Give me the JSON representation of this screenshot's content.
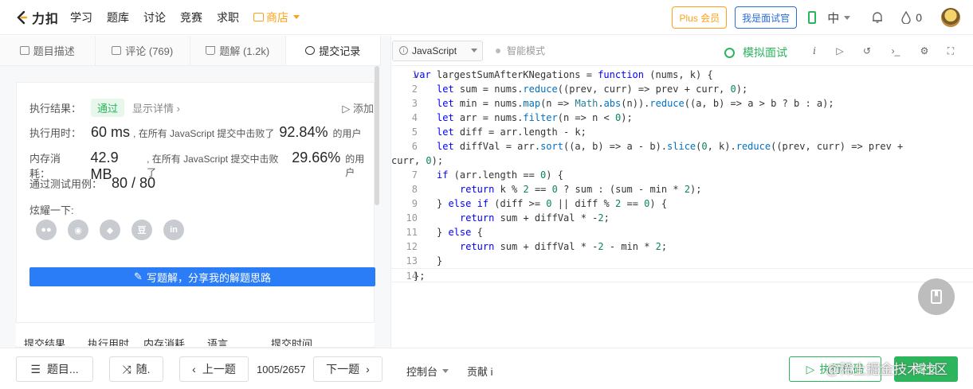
{
  "header": {
    "logo_text": "力扣",
    "nav": [
      "学习",
      "题库",
      "讨论",
      "竞赛",
      "求职"
    ],
    "store_label": "商店",
    "plus_label": "Plus 会员",
    "interview_label": "我是面试官",
    "lang_label": "中",
    "drops_count": "0"
  },
  "left_tabs": [
    {
      "label": "题目描述",
      "icon": "description-icon"
    },
    {
      "label": "评论 (769)",
      "icon": "comment-icon"
    },
    {
      "label": "题解 (1.2k)",
      "icon": "flask-icon"
    },
    {
      "label": "提交记录",
      "icon": "clock-icon"
    }
  ],
  "result": {
    "label": "执行结果：",
    "status": "通过",
    "detail_link": "显示详情 ›",
    "add_link": "▷ 添加",
    "runtime_label": "执行用时：",
    "runtime_value": "60 ms",
    "runtime_prefix": ", 在所有 JavaScript 提交中击败了",
    "runtime_pct": "92.84%",
    "runtime_suffix": "的用户",
    "memory_label": "内存消耗：",
    "memory_value": "42.9 MB",
    "memory_prefix": ", 在所有 JavaScript 提交中击败了",
    "memory_pct": "29.66%",
    "memory_suffix": "的用户",
    "tests_label": "通过测试用例：",
    "tests_value": "80 / 80",
    "share_label": "炫耀一下:",
    "share_icons": [
      "wechat-icon",
      "weibo-icon",
      "qq-icon",
      "douban-icon",
      "linkedin-icon"
    ],
    "write_button": "写题解，分享我的解题思路"
  },
  "history_header": [
    "提交结果",
    "执行用时",
    "内存消耗",
    "语言",
    "提交时间"
  ],
  "bottom": {
    "problems_label": "题目...",
    "random_label": "随.",
    "prev_label": "上一题",
    "page_count": "1005/2657",
    "next_label": "下一题",
    "console_label": "控制台",
    "contrib_label": "贡献 i",
    "run_label": "执行代码",
    "submit_label": "提交",
    "watermark": "@稀土掘金技术社区"
  },
  "editor": {
    "language": "JavaScript",
    "smart_mode": "智能模式",
    "mock_label": "模拟面试",
    "code_lines": [
      {
        "n": "1",
        "t": "var largestSumAfterKNegations = function (nums, k) {",
        "indent": 0
      },
      {
        "n": "2",
        "t": "let sum = nums.reduce((prev, curr) => prev + curr, 0);",
        "indent": 1
      },
      {
        "n": "3",
        "t": "let min = nums.map(n => Math.abs(n)).reduce((a, b) => a > b ? b : a);",
        "indent": 1
      },
      {
        "n": "4",
        "t": "let arr = nums.filter(n => n < 0);",
        "indent": 1
      },
      {
        "n": "5",
        "t": "let diff = arr.length - k;",
        "indent": 1
      },
      {
        "n": "6",
        "t": "let diffVal = arr.sort((a, b) => a - b).slice(0, k).reduce((prev, curr) => prev +",
        "indent": 1
      },
      {
        "n": "",
        "t": "curr, 0);",
        "indent": -1
      },
      {
        "n": "7",
        "t": "if (arr.length == 0) {",
        "indent": 1
      },
      {
        "n": "8",
        "t": "return k % 2 == 0 ? sum : (sum - min * 2);",
        "indent": 2
      },
      {
        "n": "9",
        "t": "} else if (diff >= 0 || diff % 2 == 0) {",
        "indent": 1
      },
      {
        "n": "10",
        "t": "return sum + diffVal * -2;",
        "indent": 2
      },
      {
        "n": "11",
        "t": "} else {",
        "indent": 1
      },
      {
        "n": "12",
        "t": "return sum + diffVal * -2 - min * 2;",
        "indent": 2
      },
      {
        "n": "13",
        "t": "}",
        "indent": 1
      },
      {
        "n": "14",
        "t": "};",
        "indent": 0
      }
    ]
  },
  "colors": {
    "accent_green": "#2db55d",
    "accent_blue": "#2a7df6",
    "accent_orange": "#ffa116"
  }
}
